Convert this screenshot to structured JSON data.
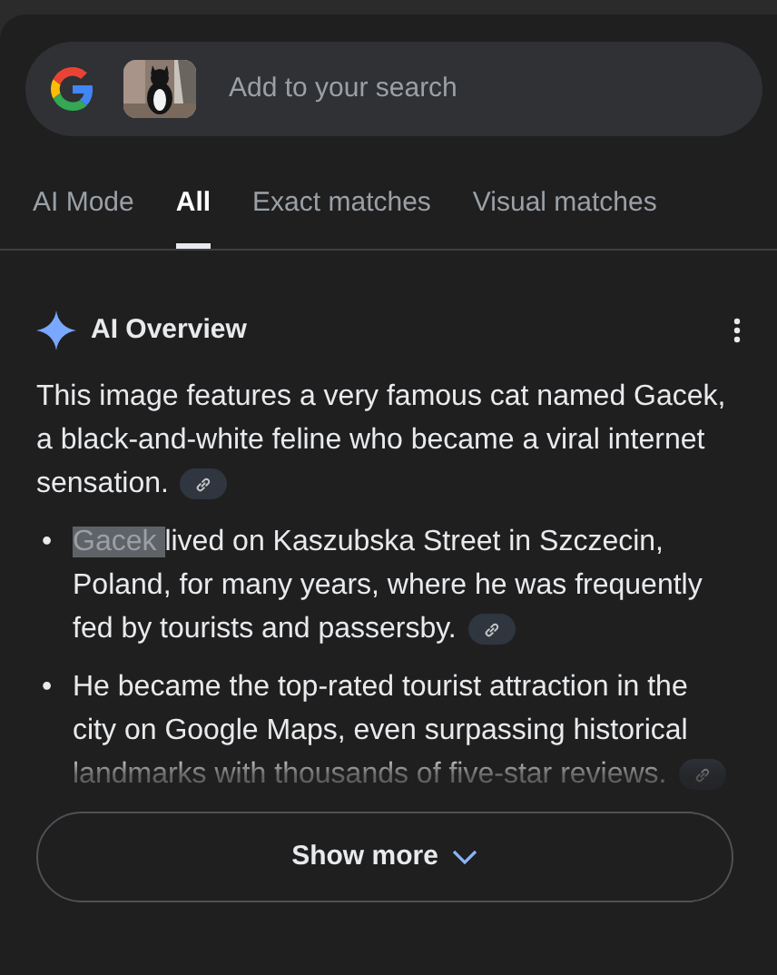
{
  "search": {
    "placeholder": "Add to your search"
  },
  "tabs": [
    {
      "label": "AI Mode",
      "selected": false
    },
    {
      "label": "All",
      "selected": true
    },
    {
      "label": "Exact matches",
      "selected": false
    },
    {
      "label": "Visual matches",
      "selected": false
    }
  ],
  "overview": {
    "title": "AI Overview",
    "intro": "This image features a very famous cat named Gacek, a black-and-white feline who became a viral internet sensation.",
    "bullets": [
      {
        "marker": "•",
        "highlight": "Gacek",
        "text": "lived on Kaszubska Street in Szczecin, Poland, for many years, where he was frequently fed by tourists and passersby.",
        "faded": false
      },
      {
        "marker": "•",
        "text": "He became the top-rated tourist attraction in the city on Google Maps, even surpassing historical landmarks with thousands of five-star reviews.",
        "faded": true
      }
    ],
    "show_more": "Show more"
  }
}
